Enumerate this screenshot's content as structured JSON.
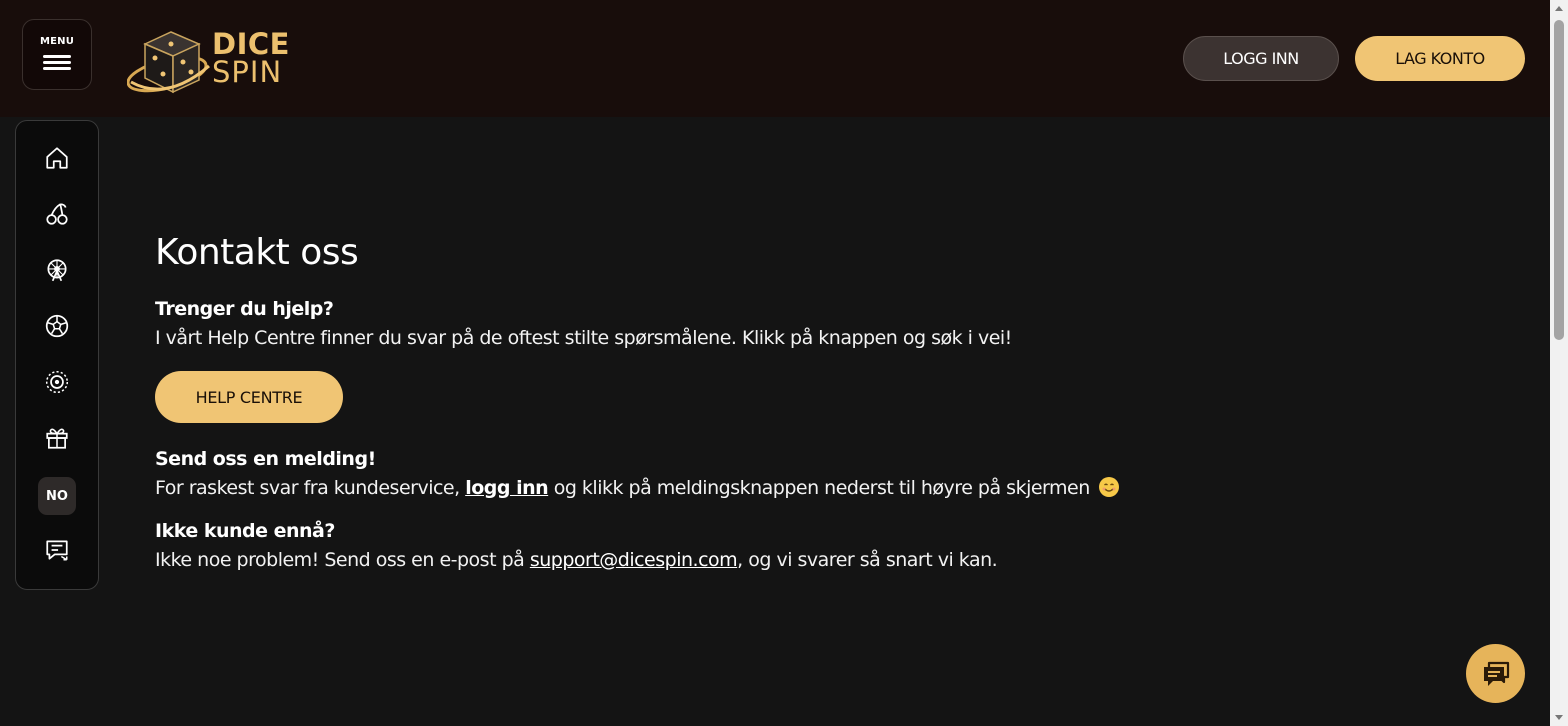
{
  "header": {
    "menu_label": "MENU",
    "logo_line1": "DICE",
    "logo_line2": "SPIN",
    "login_label": "LOGG INN",
    "signup_label": "LAG KONTO"
  },
  "sidebar": {
    "items": [
      {
        "icon": "home-icon"
      },
      {
        "icon": "cherry-icon"
      },
      {
        "icon": "ferris-wheel-icon"
      },
      {
        "icon": "soccer-ball-icon"
      },
      {
        "icon": "target-icon"
      },
      {
        "icon": "gift-icon"
      },
      {
        "icon": "language-badge",
        "label": "NO"
      },
      {
        "icon": "chat-support-icon"
      }
    ]
  },
  "main": {
    "title": "Kontakt oss",
    "help": {
      "heading": "Trenger du hjelp?",
      "text": "I vårt Help Centre finner du svar på de oftest stilte spørsmålene. Klikk på knappen og søk i vei!",
      "button": "HELP CENTRE"
    },
    "message": {
      "heading": "Send oss en melding!",
      "text_before": "For raskest svar fra kundeservice, ",
      "link": "logg inn",
      "text_after": " og klikk på meldingsknappen nederst til høyre på skjermen"
    },
    "not_customer": {
      "heading": "Ikke kunde ennå?",
      "text_before": "Ikke noe problem! Send oss en e-post på ",
      "email": "support@dicespin.com",
      "text_after": ", og vi svarer så snart vi kan."
    }
  },
  "colors": {
    "accent": "#f0c574",
    "header_bg": "#180d0b",
    "page_bg": "#141414"
  }
}
